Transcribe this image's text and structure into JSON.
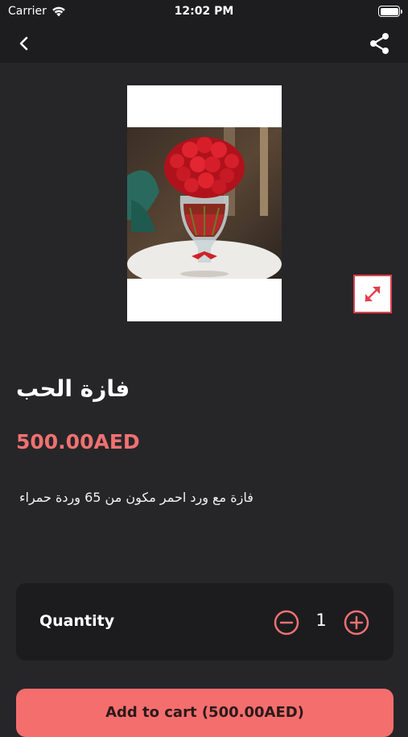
{
  "status": {
    "carrier": "Carrier",
    "time": "12:02 PM"
  },
  "nav": {
    "back_icon": "chevron-left-icon",
    "share_icon": "share-icon"
  },
  "product": {
    "title": "فازة الحب",
    "price": "500.00AED",
    "description": "فازة مع ورد احمر مكون من 65 وردة حمراء"
  },
  "quantity": {
    "label": "Quantity",
    "value": "1"
  },
  "cart": {
    "label": "Add to cart (500.00AED)"
  },
  "colors": {
    "background": "#262628",
    "bar": "#1d1d1f",
    "accent": "#f56e6e",
    "price": "#f07171"
  }
}
